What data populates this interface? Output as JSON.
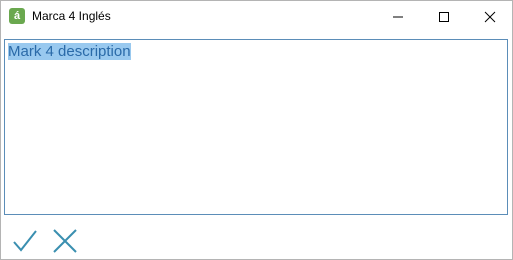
{
  "window": {
    "title": "Marca 4 Inglés",
    "app_icon_glyph": "á",
    "app_icon_color": "#6aa84f"
  },
  "controls": {
    "minimize_icon": "minimize-icon",
    "maximize_icon": "maximize-icon",
    "close_icon": "close-icon"
  },
  "editor": {
    "value": "Mark 4 description",
    "selection_color": "#99c9ef",
    "text_color": "#2a6aa8",
    "border_color": "#5b8db8"
  },
  "actions": {
    "confirm_icon": "checkmark-icon",
    "cancel_icon": "cross-icon",
    "icon_color": "#3a8fb0"
  }
}
